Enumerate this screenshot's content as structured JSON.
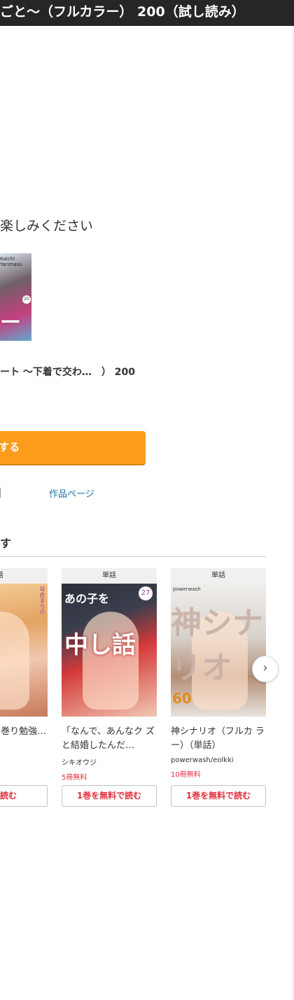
{
  "header": {
    "title": "ごと〜（フルカラー） 200（試し読み）"
  },
  "main": {
    "headline": "楽しみください",
    "cover_tag": "Kaichi Yarimasu",
    "cover_badge": "20",
    "cover_big": "ート",
    "work_title": "ート 〜下着で交わ…　） 200",
    "primary_button": "する",
    "work_page_link": "作品ページ"
  },
  "recommend": {
    "section_title": "す",
    "cards": [
      {
        "label": "話",
        "title": "ャルとガリ 巻り勉強…",
        "author": "",
        "free_label": "",
        "button": "料で読む",
        "cover_text": "琴倉まちの"
      },
      {
        "label": "単話",
        "title": "「なんで、あんなク ズと結婚したんだ…",
        "author": "シキオウジ",
        "free_label": "5冊無料",
        "button": "1巻を無料で読む",
        "cover_title": "あの子を",
        "cover_big": "中し話",
        "cover_vol": "27"
      },
      {
        "label": "単話",
        "title": "神シナリオ（フルカ ラー）（単話）",
        "author": "powerwash/eolkki",
        "free_label": "10冊無料",
        "button": "1巻を無料で読む",
        "cover_pub": "powerwash",
        "cover_big": "神シナリオ",
        "cover_vol": "60"
      }
    ]
  },
  "icons": {
    "next": "chevron-right-icon"
  }
}
